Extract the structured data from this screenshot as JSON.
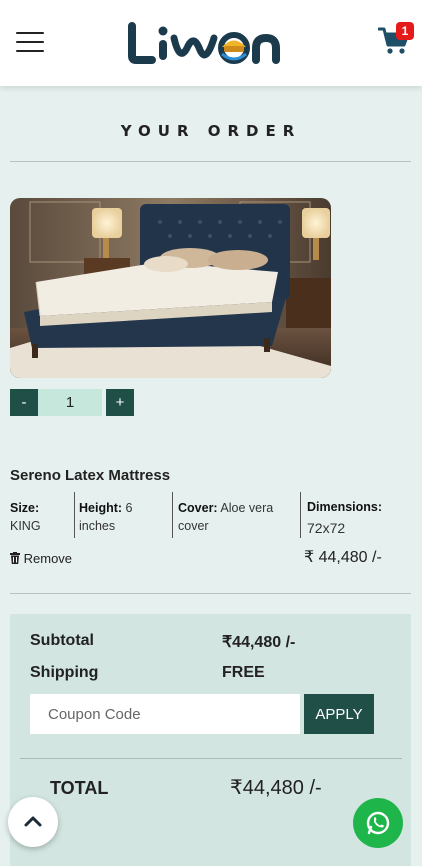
{
  "header": {
    "brand": "Liwon",
    "cart_count": "1"
  },
  "page": {
    "title": "YOUR ORDER"
  },
  "item": {
    "quantity": "1",
    "minus_label": "-",
    "plus_label": "+",
    "name": "Sereno Latex Mattress",
    "size_label": "Size:",
    "size_value": "KING",
    "height_label": "Height:",
    "height_value": "6 inches",
    "cover_label": "Cover:",
    "cover_value": "Aloe vera cover",
    "dimensions_label": "Dimensions:",
    "dimensions_value": "72x72",
    "remove_label": "Remove",
    "price": "₹ 44,480 /-"
  },
  "summary": {
    "subtotal_label": "Subtotal",
    "subtotal_value": "₹44,480 /-",
    "shipping_label": "Shipping",
    "shipping_value": "FREE",
    "coupon_placeholder": "Coupon Code",
    "apply_label": "APPLY",
    "total_label": "TOTAL",
    "total_value": "₹44,480 /-"
  },
  "colors": {
    "accent": "#1f4f47",
    "page_bg": "#e6f1ef",
    "summary_bg": "#d2e5e1",
    "badge": "#e51b1b",
    "whatsapp": "#1eb64b"
  },
  "icons": [
    "menu-icon",
    "cart-icon",
    "trash-icon",
    "chevron-up-icon",
    "whatsapp-icon"
  ]
}
